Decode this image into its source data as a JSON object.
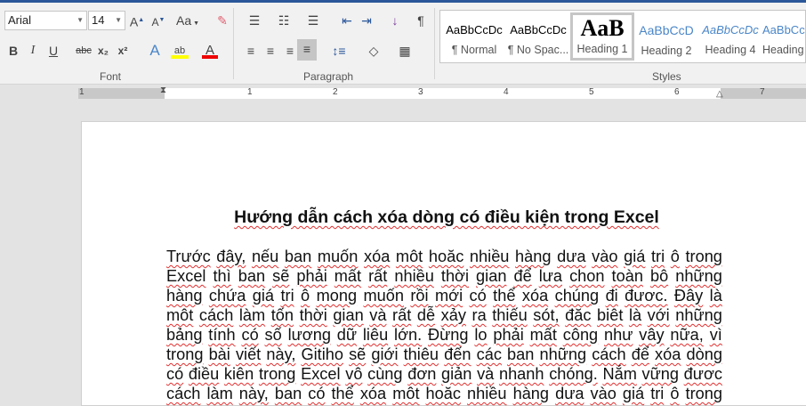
{
  "ribbon": {
    "font_name": "Arial",
    "font_size": "14",
    "change_case": "Aa",
    "bold": "B",
    "italic": "I",
    "underline": "U",
    "strike": "abc",
    "subscript": "x₂",
    "superscript": "x²",
    "font_group": "Font",
    "paragraph_group": "Paragraph",
    "styles_group": "Styles",
    "highlight_color": "#ffff00",
    "font_color": "#ff0000",
    "accent": "#2b579a"
  },
  "styles": [
    {
      "preview": "AaBbCcDc",
      "name": "¶ Normal"
    },
    {
      "preview": "AaBbCcDc",
      "name": "¶ No Spac..."
    },
    {
      "preview": "AaB",
      "name": "Heading 1",
      "selected": true
    },
    {
      "preview": "AaBbCcD",
      "name": "Heading 2"
    },
    {
      "preview": "AaBbCcDc",
      "name": "Heading 4"
    },
    {
      "preview": "AaBbCc",
      "name": "Heading"
    }
  ],
  "ruler": {
    "labels": [
      "1",
      "1",
      "2",
      "3",
      "4",
      "5",
      "6",
      "7"
    ]
  },
  "document": {
    "title": "Hướng dẫn cách xóa dòng có điều kiện trong Excel",
    "lines": [
      "Trước đây, nếu ban muốn xóa môt hoăc nhiều hàng dưa vào giá tri ô trong",
      "Excel thì ban sẽ phải mất rất nhiều thời gian để lưa chon toàn bô những",
      "hàng chứa giá tri ô mong muốn rồi mới có thể xóa chúng đi đươc. Đây là",
      "môt cách làm tốn thời gian và rất dễ xảy ra thiếu sót, đăc biêt là với những",
      "bảng tính có số lương dữ liêu lớn. Đừng lo phải mất công như vây nữa, vì",
      "trong bài viết này, Gitiho sẽ giới thiêu đến các ban những cách để xóa dòng",
      "có điều kiên trong Excel vô cùng đơn giản và nhanh chóng. Nắm vững đươc",
      "cách làm này, ban có thể xóa môt hoăc nhiều hàng dưa vào giá tri ô trong"
    ]
  }
}
